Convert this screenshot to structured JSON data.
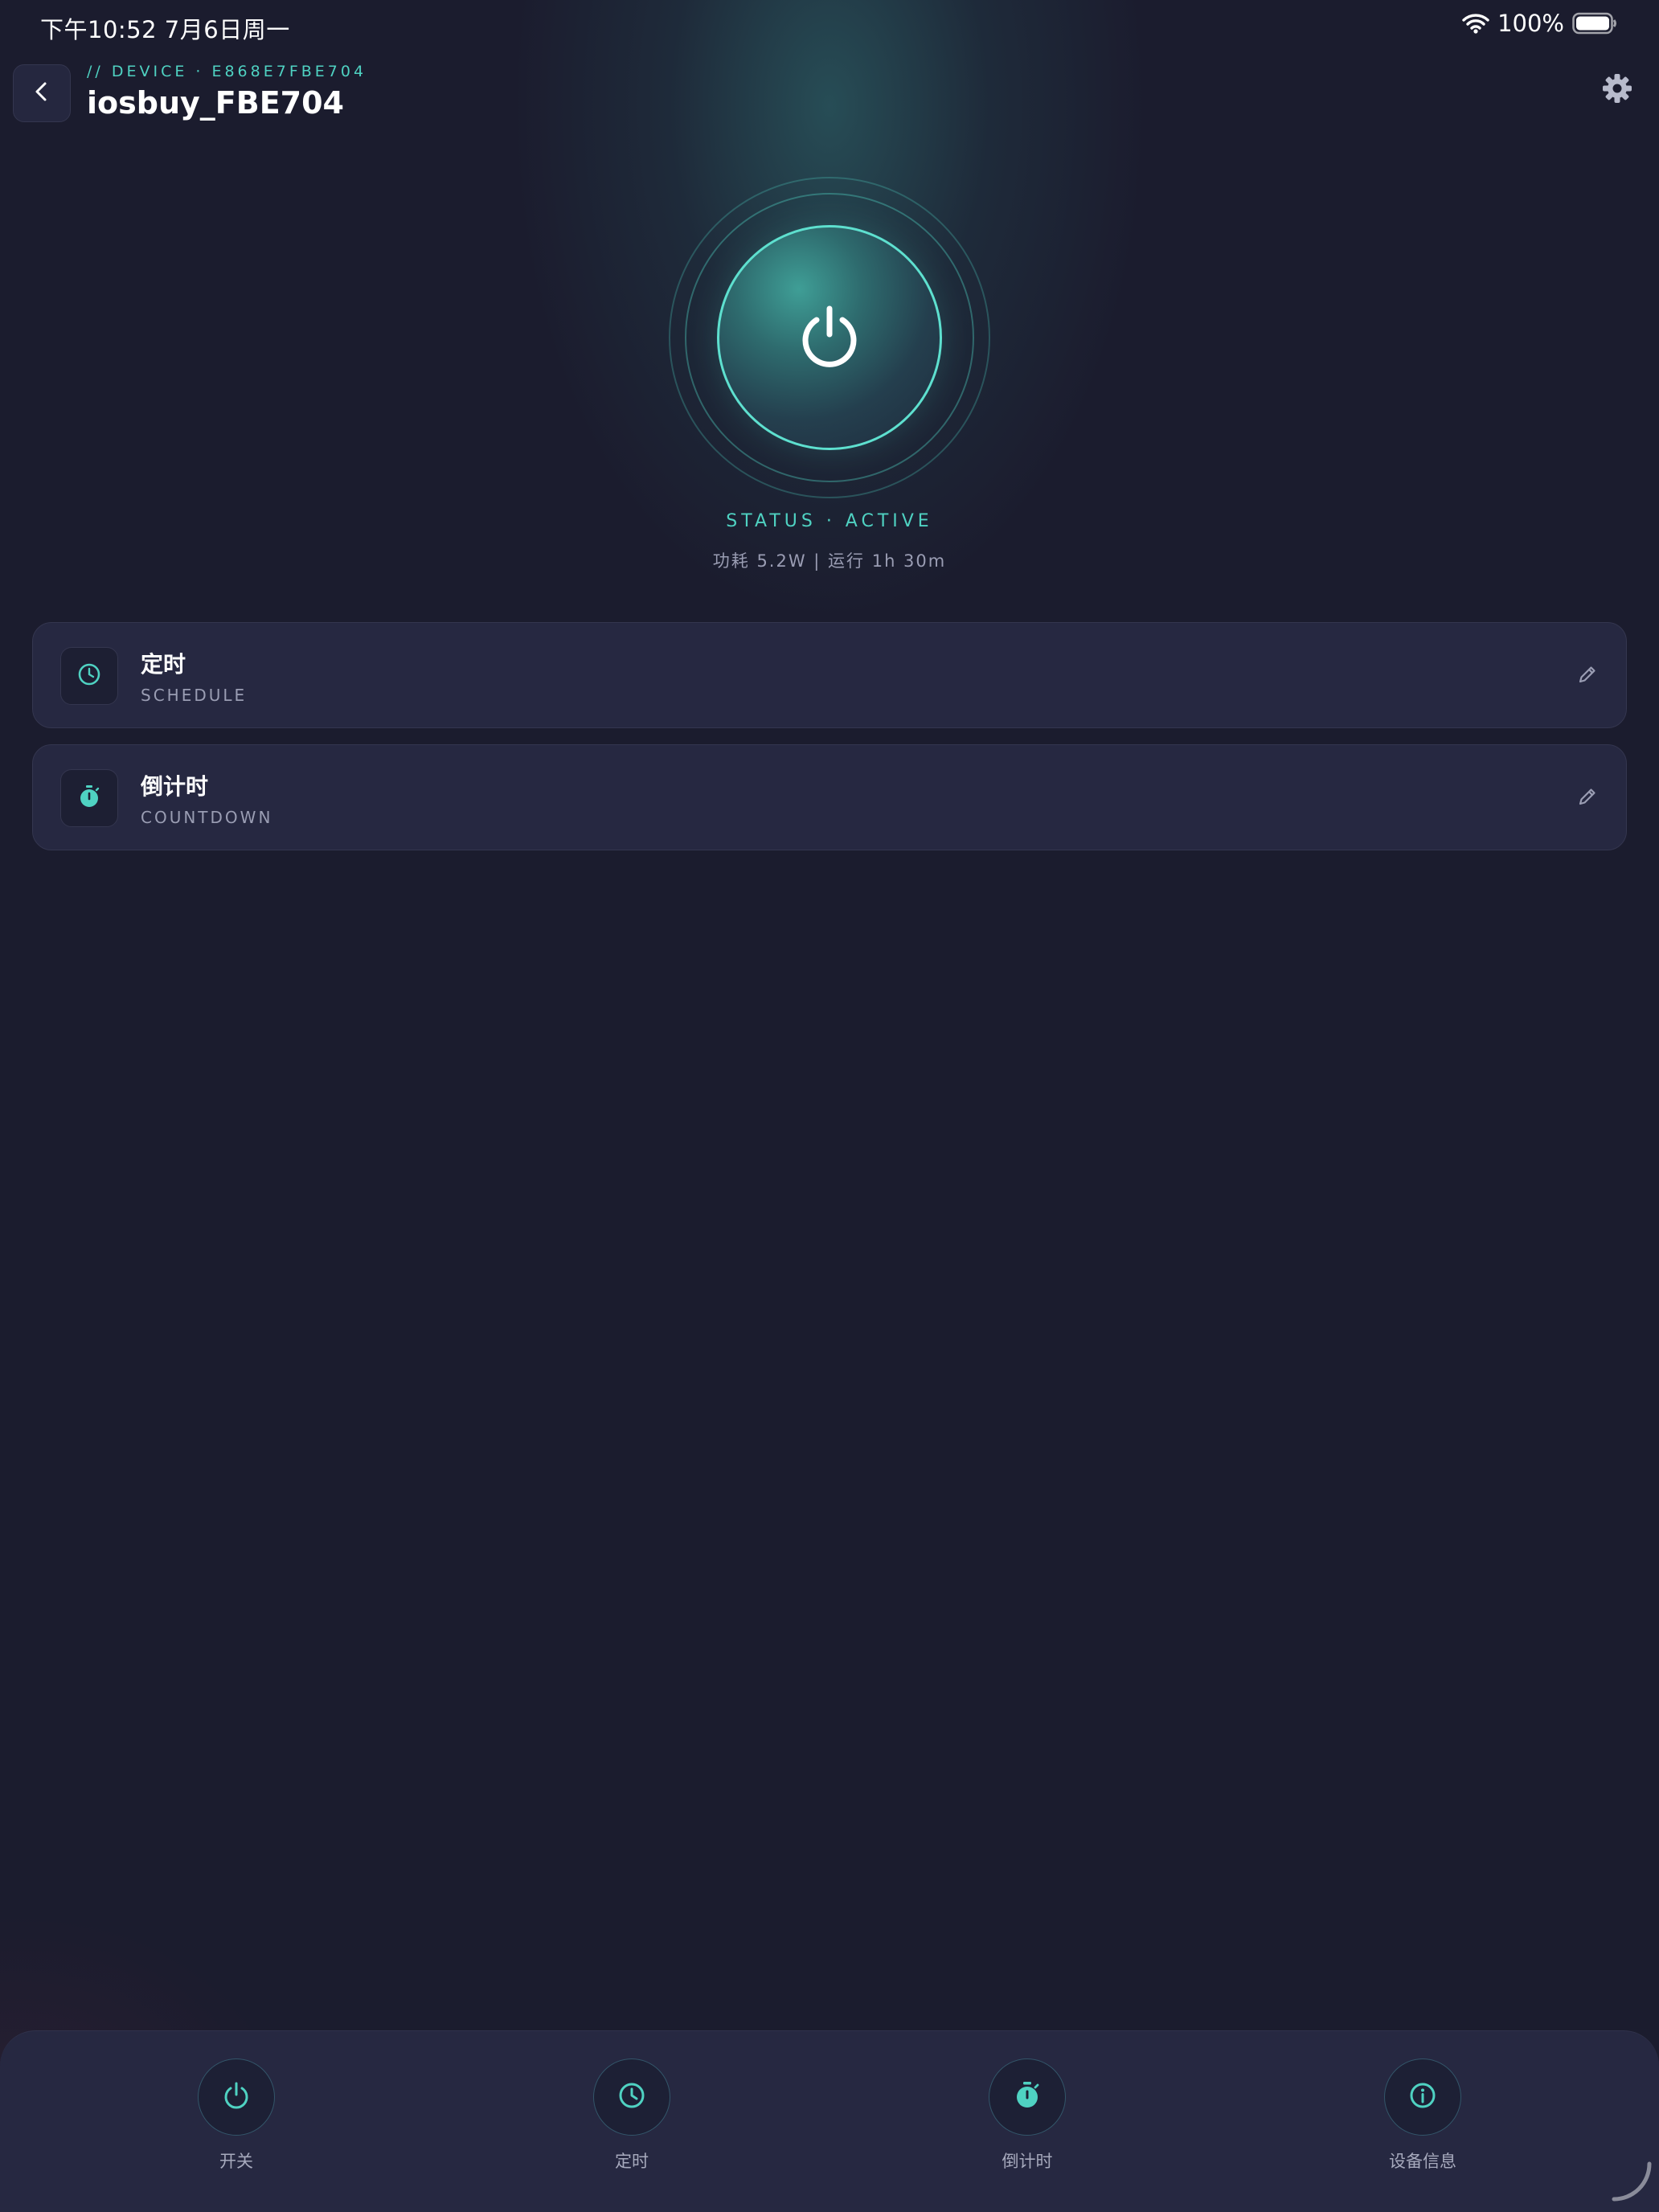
{
  "status_bar": {
    "time_date": "下午10:52   7月6日周一",
    "battery_percent": "100%"
  },
  "header": {
    "device_id": "// DEVICE · E868E7FBE704",
    "title": "iosbuy_FBE704"
  },
  "power": {
    "status": "STATUS · ACTIVE",
    "stats": "功耗 5.2W  |  运行 1h 30m"
  },
  "cards": [
    {
      "title": "定时",
      "subtitle": "SCHEDULE",
      "icon": "clock-icon"
    },
    {
      "title": "倒计时",
      "subtitle": "COUNTDOWN",
      "icon": "stopwatch-icon"
    }
  ],
  "nav": [
    {
      "label": "开关",
      "icon": "power-icon"
    },
    {
      "label": "定时",
      "icon": "clock-icon"
    },
    {
      "label": "倒计时",
      "icon": "stopwatch-icon"
    },
    {
      "label": "设备信息",
      "icon": "info-icon"
    }
  ],
  "colors": {
    "background": "#1b1c2e",
    "card": "#262841",
    "accent": "#4fd2c2",
    "muted_text": "#9a9db3"
  }
}
